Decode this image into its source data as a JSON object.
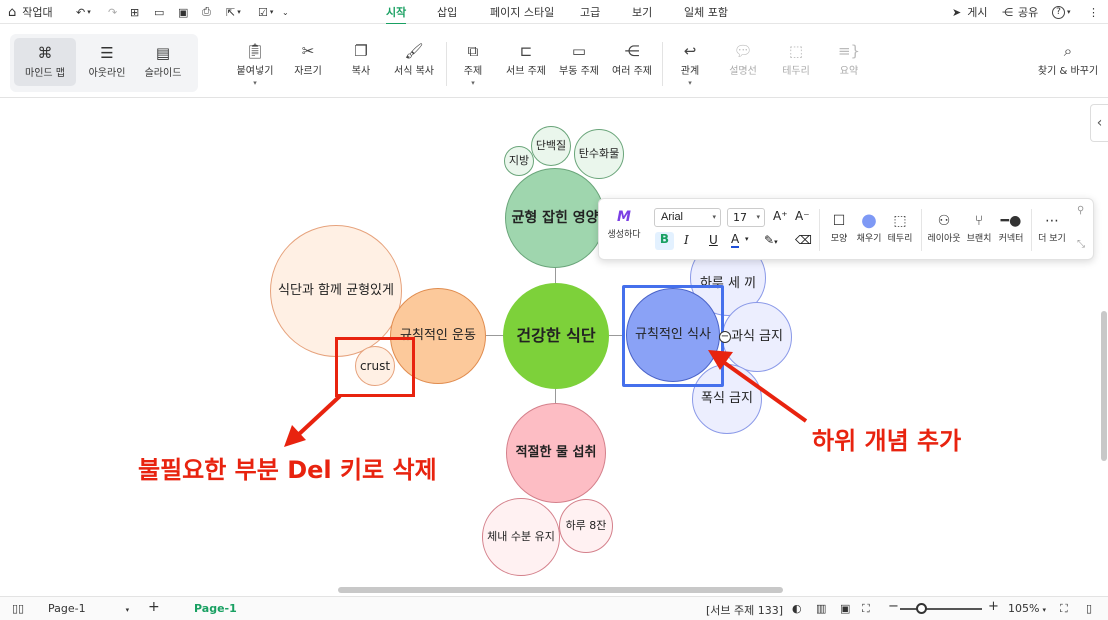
{
  "topbar": {
    "home_label": "작업대",
    "tabs": [
      "시작",
      "삽입",
      "페이지 스타일",
      "고급",
      "보기",
      "일체 포함"
    ],
    "publish_label": "게시",
    "share_label": "공유",
    "help_label": "?"
  },
  "views": {
    "mindmap": "마인드 맵",
    "outline": "아웃라인",
    "slide": "슬라이드"
  },
  "ribbon": {
    "paste": "붙여넣기",
    "cut": "자르기",
    "copy": "복사",
    "format_copy": "서식 복사",
    "topic": "주제",
    "subtopic": "서브 주제",
    "floating": "부동 주제",
    "multiple": "여러 주제",
    "relation": "관계",
    "callout": "설명선",
    "boundary": "테두리",
    "summary": "요약",
    "find_replace": "찾기 & 바꾸기"
  },
  "mindmap": {
    "center": "건강한 식단",
    "balanced": "균형 잡힌 영양",
    "protein": "단백질",
    "carbs": "탄수화물",
    "fat": "지방",
    "exercise": "규칙적인 운동",
    "exercise_child": "식단과 함께 균형있게",
    "crust": "crust",
    "regular": "규칙적인 식사",
    "three_meals": "하루 세 끼",
    "no_snack": "과식 금지",
    "no_binge": "폭식 금지",
    "water": "적절한 물 섭취",
    "hydration": "체내 수분 유지",
    "eight_glasses": "하루 8잔"
  },
  "format_toolbar": {
    "ai_label": "생성하다",
    "font": "Arial",
    "size": "17",
    "bold": "B",
    "italic": "I",
    "underline": "U",
    "color_a": "A",
    "shape": "모양",
    "fill": "채우기",
    "border": "테두리",
    "layout": "레이아웃",
    "branch": "브랜치",
    "connector": "커넥터",
    "more": "더 보기"
  },
  "annotations": {
    "left": "불필요한 부분 Del 키로 삭제",
    "right": "하위 개념 추가"
  },
  "statusbar": {
    "page_select": "Page-1",
    "page_tab": "Page-1",
    "subtopic_count": "[서브 주제 133]",
    "zoom": "105%"
  },
  "colors": {
    "accent": "#19a062",
    "annotation": "#e8230f",
    "selection": "#4570ec"
  }
}
